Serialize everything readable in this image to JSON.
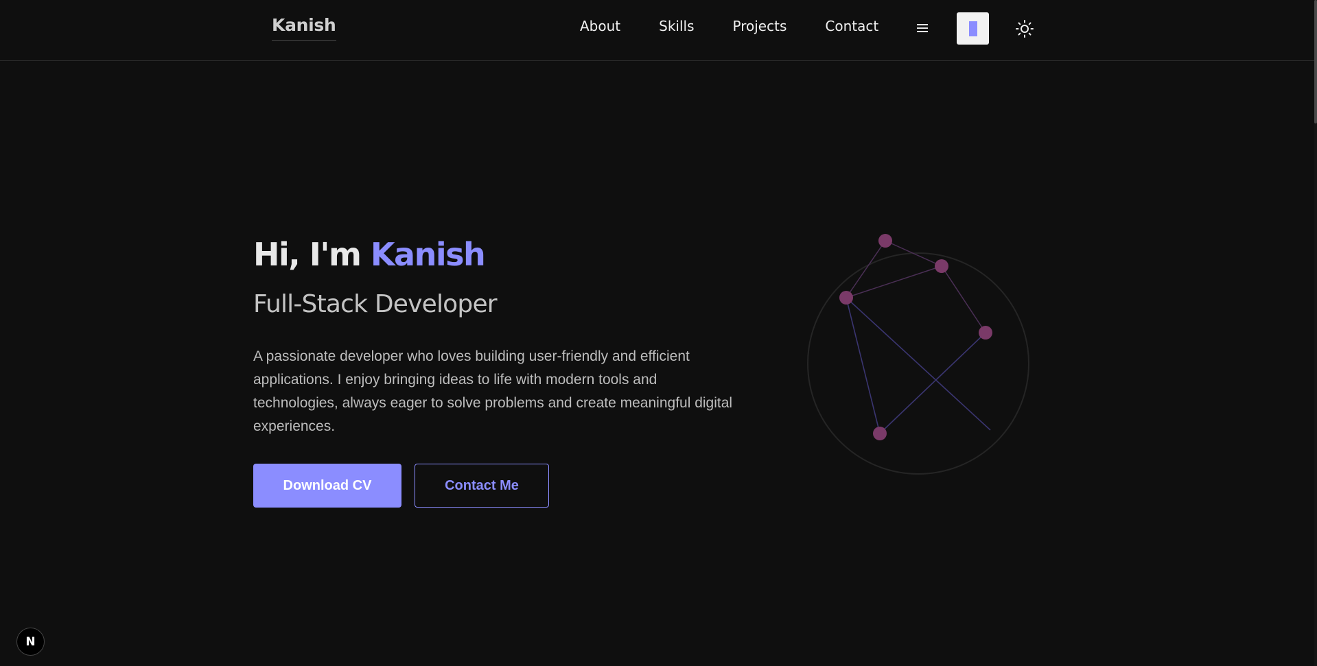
{
  "header": {
    "brand": "Kanish",
    "nav": [
      {
        "label": "About"
      },
      {
        "label": "Skills"
      },
      {
        "label": "Projects"
      },
      {
        "label": "Contact"
      }
    ],
    "menu_icon": "hamburger-menu-icon",
    "theme_icon": "sun-icon",
    "accent_color": "#8b8dff"
  },
  "hero": {
    "greeting": "Hi, I'm ",
    "name": "Kanish",
    "subtitle": "Full-Stack Developer",
    "description": "A passionate developer who loves building user-friendly and efficient applications. I enjoy bringing ideas to life with modern tools and technologies, always eager to solve problems and create meaningful digital experiences.",
    "primary_button": "Download CV",
    "secondary_button": "Contact Me"
  },
  "badge": {
    "label": "N"
  },
  "colors": {
    "background": "#0f0f0f",
    "accent": "#8b8dff",
    "node": "#7a3a68"
  }
}
